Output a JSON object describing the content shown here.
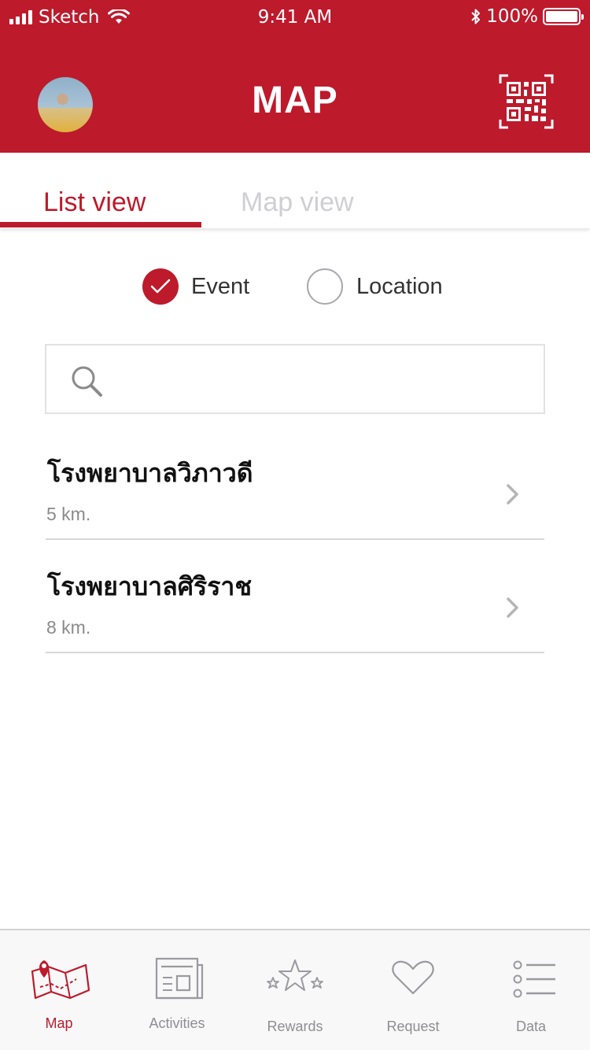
{
  "status_bar": {
    "carrier": "Sketch",
    "time": "9:41 AM",
    "battery": "100%"
  },
  "header": {
    "title": "MAP",
    "avatar": "user-avatar",
    "qr_icon": "qr-code-icon"
  },
  "tabs": [
    {
      "label": "List view",
      "active": true
    },
    {
      "label": "Map view",
      "active": false
    }
  ],
  "filters": [
    {
      "label": "Event",
      "checked": true
    },
    {
      "label": "Location",
      "checked": false
    }
  ],
  "search": {
    "placeholder": "",
    "value": ""
  },
  "list": [
    {
      "title": "โรงพยาบาลวิภาวดี",
      "distance": "5 km."
    },
    {
      "title": "โรงพยาบาลศิริราช",
      "distance": "8 km."
    }
  ],
  "tab_bar": [
    {
      "label": "Map",
      "icon": "map-icon",
      "active": true
    },
    {
      "label": "Activities",
      "icon": "newspaper-icon",
      "active": false
    },
    {
      "label": "Rewards",
      "icon": "stars-icon",
      "active": false
    },
    {
      "label": "Request",
      "icon": "heart-icon",
      "active": false
    },
    {
      "label": "Data",
      "icon": "list-icon",
      "active": false
    }
  ],
  "colors": {
    "brand": "#bd1a2c",
    "inactive": "#8e8e93",
    "tab_inactive": "#cfcfd3"
  }
}
